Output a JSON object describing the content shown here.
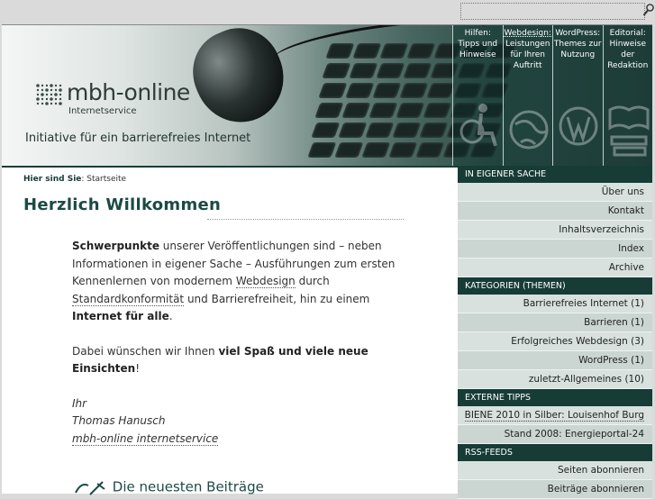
{
  "search": {
    "placeholder": ""
  },
  "header": {
    "logo": "mbh-online",
    "logo_sub": "Internetservice",
    "tagline": "Initiative für ein barrierefreies Internet",
    "topnav": [
      {
        "lines": [
          "Hilfen:",
          "Tipps und",
          "Hinweise"
        ]
      },
      {
        "lines": [
          "Webdesign:",
          "Leistungen",
          "für Ihren",
          "Auftritt"
        ]
      },
      {
        "lines": [
          "WordPress:",
          "Themes zur",
          "Nutzung"
        ]
      },
      {
        "lines": [
          "Editorial:",
          "Hinweise",
          "der",
          "Redaktion"
        ]
      }
    ]
  },
  "breadcrumb": {
    "label": "Hier sind Sie",
    "current": "Startseite"
  },
  "main": {
    "title": "Herzlich Willkommen",
    "p1_strong1": "Schwerpunkte",
    "p1_a": " unserer Veröffentlichungen sind – neben Informationen in eigener Sache – Ausführungen zum ersten Kennenlernen von modernem ",
    "p1_link1": "Webdesign",
    "p1_b": " durch ",
    "p1_link2": "Standardkonformität",
    "p1_c": " und Barrierefreiheit, hin zu einem ",
    "p1_strong2": "Internet für alle",
    "p1_d": ".",
    "p2_a": "Dabei wünschen wir Ihnen ",
    "p2_strong": "viel Spaß und viele neue Einsichten",
    "p2_b": "!",
    "sig1": "Ihr",
    "sig2": "Thomas Hanusch",
    "sig3": "mbh-online internetservice",
    "newest": "Die neuesten Beiträge"
  },
  "sidebar": {
    "sections": [
      {
        "head": "IN EIGENER SACHE",
        "items": [
          "Über uns",
          "Kontakt",
          "Inhaltsverzeichnis",
          "Index",
          "Archive"
        ]
      },
      {
        "head": "KATEGORIEN (THEMEN)",
        "items": [
          "Barrierefreies Internet (1)",
          "Barrieren (1)",
          "Erfolgreiches Webdesign (3)",
          "WordPress (1)",
          "zuletzt-Allgemeines (10)"
        ]
      },
      {
        "head": "EXTERNE TIPPS",
        "items": [
          "BIENE 2010 in Silber: Louisenhof Burg",
          "Stand 2008: Energieportal-24"
        ]
      },
      {
        "head": "RSS-FEEDS",
        "items": [
          "Seiten abonnieren",
          "Beiträge abonnieren"
        ]
      }
    ]
  }
}
